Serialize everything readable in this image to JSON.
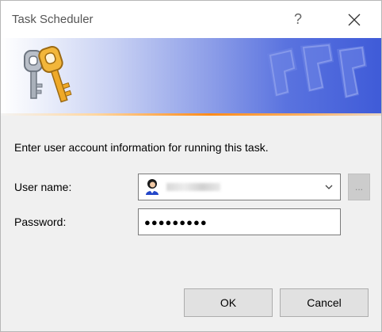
{
  "window": {
    "title": "Task Scheduler",
    "help_label": "?",
    "close_icon": "close-icon"
  },
  "banner": {
    "icon": "keys-icon",
    "accent_color": "#ff8c1a",
    "gradient_end_color": "#3f5bd8"
  },
  "form": {
    "instruction": "Enter user account information for running this task.",
    "user_label": "User name:",
    "user_value_redacted": true,
    "user_icon": "user-avatar-icon",
    "browse_label": "...",
    "password_label": "Password:",
    "password_value": "●●●●●●●●●"
  },
  "buttons": {
    "ok": "OK",
    "cancel": "Cancel"
  }
}
